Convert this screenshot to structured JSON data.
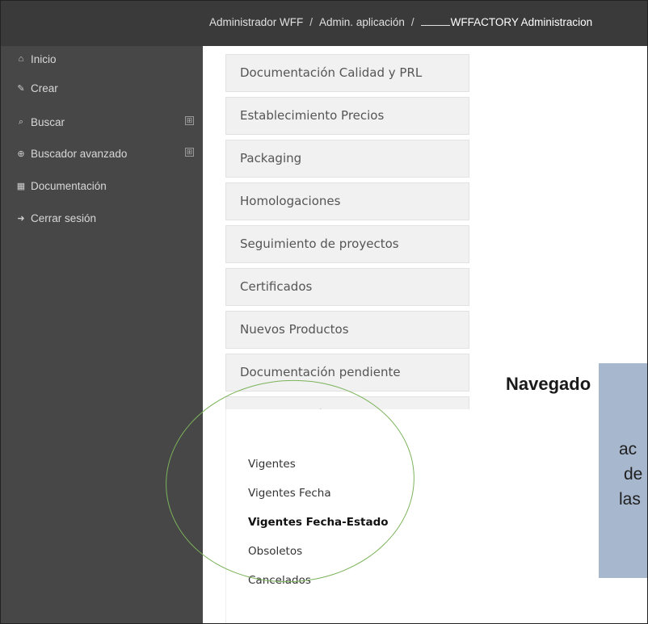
{
  "breadcrumb": {
    "level1": "Administrador WFF",
    "sep": "/",
    "level2": "Admin. aplicación",
    "current": "WFFACTORY Administracion"
  },
  "sidebar": {
    "items": [
      {
        "label": "Inicio",
        "icon": "home-icon",
        "glyph": "⌂"
      },
      {
        "label": "Crear",
        "icon": "edit-icon",
        "glyph": "✎"
      },
      {
        "label": "Buscar",
        "icon": "search-icon",
        "glyph": "⌕"
      },
      {
        "label": "Buscador avanzado",
        "icon": "advanced-search-icon",
        "glyph": "⊕"
      },
      {
        "label": "Documentación",
        "icon": "grid-icon",
        "glyph": "▦"
      },
      {
        "label": "Cerrar sesión",
        "icon": "sign-out-icon",
        "glyph": "➜"
      }
    ],
    "expand_glyph": "⊞"
  },
  "menu": {
    "items": [
      "Documentación Calidad y PRL",
      "Establecimiento Precios",
      "Packaging",
      "Homologaciones",
      "Seguimiento de proyectos",
      "Certificados",
      "Nuevos Productos",
      "Documentación pendiente",
      "Administración"
    ],
    "submenu": [
      "Vigentes",
      "Vigentes Fecha",
      "Vigentes Fecha-Estado",
      "Obsoletos",
      "Cancelados"
    ],
    "active_sub": "Vigentes Fecha-Estado"
  },
  "callout": {
    "title": "Navegado",
    "lines": [
      "ac",
      "de",
      "las"
    ]
  },
  "colors": {
    "topbar": "#3a3a3a",
    "sidebar": "#474747",
    "callout_box": "#a7b7cd",
    "highlight_ellipse": "#7bb35a"
  }
}
